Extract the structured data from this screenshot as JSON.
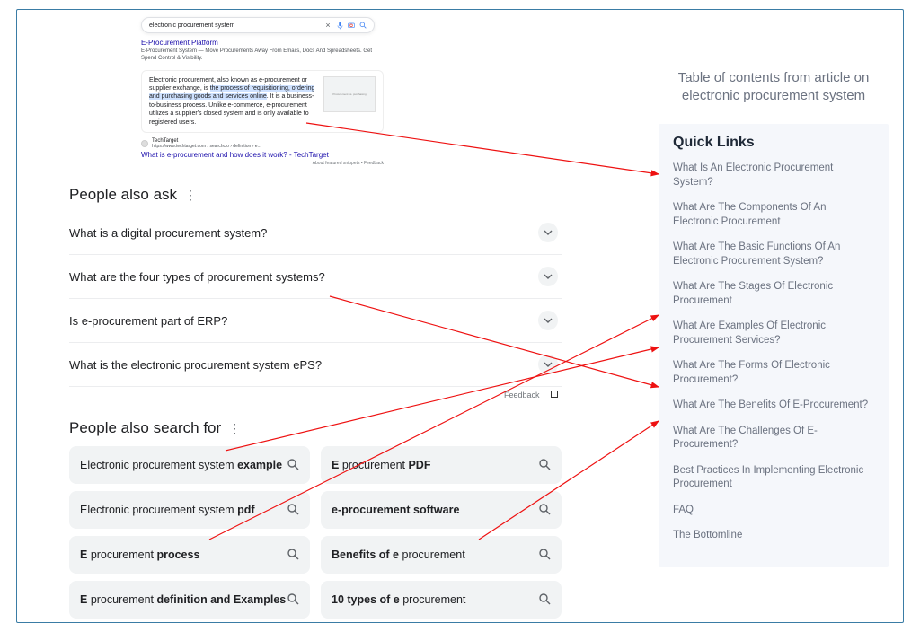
{
  "search": {
    "query": "electronic procurement system",
    "clear_label": "×",
    "mic_label": "🎤",
    "lens_label": "⌕",
    "search_label": "🔍"
  },
  "ad": {
    "title": "E-Procurement Platform",
    "sub": "E-Procurement System — Move Procurements Away From Emails, Docs And Spreadsheets. Get Spend Control & Visibility."
  },
  "snippet": {
    "pre": "Electronic procurement, also known as e-procurement or supplier exchange, is ",
    "highlight": "the process of requisitioning, ordering and purchasing goods and services online",
    "post": ". It is a business-to-business process. Unlike e-commerce, e-procurement utilizes a supplier's closed system and is only available to registered users.",
    "thumb_caption": "Procurement vs. purchasing"
  },
  "source": {
    "name": "TechTarget",
    "url": "https://www.techtarget.com › searchcio › definition › e...",
    "title": "What is e-procurement and how does it work? - TechTarget",
    "feedback": "About featured snippets  •  Feedback"
  },
  "paa": {
    "heading": "People also ask",
    "items": [
      "What is a digital procurement system?",
      "What are the four types of procurement systems?",
      "Is e-procurement part of ERP?",
      "What is the electronic procurement system ePS?"
    ],
    "feedback": "Feedback"
  },
  "pasf": {
    "heading": "People also search for",
    "items": [
      {
        "plain": "Electronic procurement system ",
        "bold": "example"
      },
      {
        "bold": "E",
        "plain2": " procurement ",
        "bold2": "PDF"
      },
      {
        "plain": "Electronic procurement system ",
        "bold": "pdf"
      },
      {
        "bold": "e-procurement software"
      },
      {
        "bold": "E",
        "plain2": " procurement ",
        "bold2": "process"
      },
      {
        "bold": "Benefits of e",
        "plain2": " procurement"
      },
      {
        "bold": "E",
        "plain2": " procurement ",
        "bold2": "definition and Examples"
      },
      {
        "bold": "10 types of e",
        "plain2": " procurement"
      }
    ]
  },
  "toc": {
    "title": "Table of contents from article on electronic procurement system",
    "ql_heading": "Quick Links",
    "links": [
      "What Is An Electronic Procurement System?",
      "What Are The Components Of An Electronic Procurement",
      "What Are The Basic Functions Of An Electronic Procurement System?",
      "What Are The Stages Of Electronic Procurement",
      "What Are Examples Of Electronic Procurement Services?",
      "What Are The Forms Of Electronic Procurement?",
      "What Are The Benefits Of E-Procurement?",
      "What Are The Challenges Of E-Procurement?",
      "Best Practices In Implementing Electronic Procurement",
      "FAQ",
      "The Bottomline"
    ]
  },
  "arrow_annotations": [
    {
      "from": "snippet",
      "to_link_index": 0
    },
    {
      "from": "paa_1",
      "to_link_index": 5
    },
    {
      "from": "pasf_0",
      "to_link_index": 4
    },
    {
      "from": "pasf_4",
      "to_link_index": 3
    },
    {
      "from": "pasf_5",
      "to_link_index": 6
    }
  ]
}
